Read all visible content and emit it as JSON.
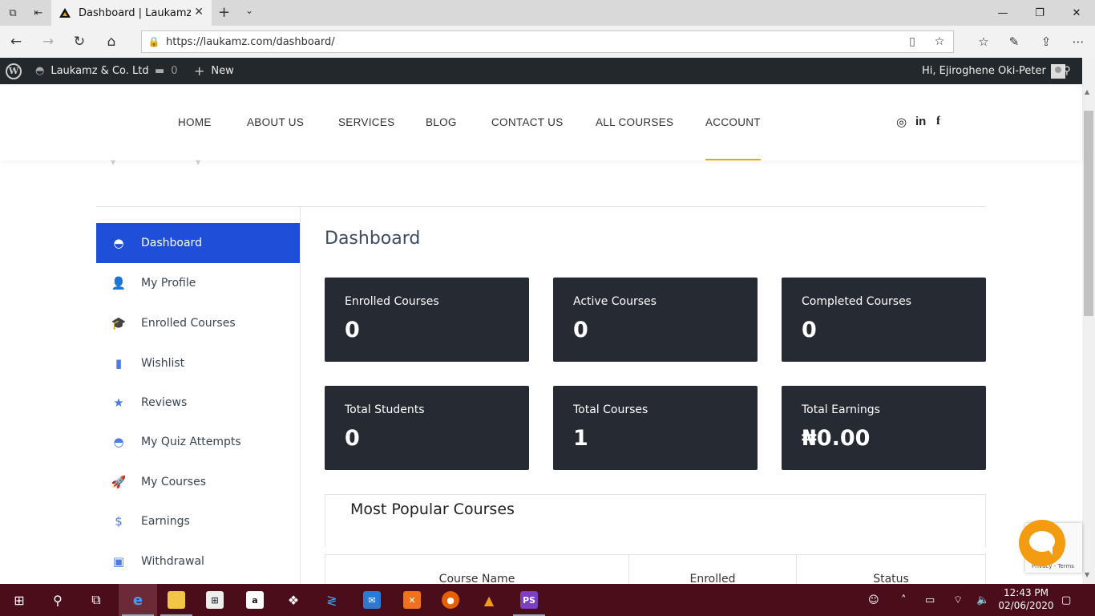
{
  "browser": {
    "tab_title": "Dashboard | Laukamz &",
    "url": "https://laukamz.com/dashboard/"
  },
  "wp_admin_bar": {
    "site_name": "Laukamz & Co. Ltd",
    "comments_count": "0",
    "new_label": "New",
    "greeting": "Hi, Ejiroghene Oki-Peter"
  },
  "nav": {
    "items": [
      "HOME",
      "ABOUT US",
      "SERVICES",
      "BLOG",
      "CONTACT US",
      "ALL COURSES",
      "ACCOUNT"
    ],
    "active": "ACCOUNT",
    "accent_color": "#f0a500"
  },
  "sidebar": {
    "items": [
      {
        "label": "Dashboard",
        "icon": "gauge-icon"
      },
      {
        "label": "My Profile",
        "icon": "user-icon"
      },
      {
        "label": "Enrolled Courses",
        "icon": "graduation-cap-icon"
      },
      {
        "label": "Wishlist",
        "icon": "bookmark-icon"
      },
      {
        "label": "Reviews",
        "icon": "star-icon"
      },
      {
        "label": "My Quiz Attempts",
        "icon": "gauge-icon"
      },
      {
        "label": "My Courses",
        "icon": "rocket-icon"
      },
      {
        "label": "Earnings",
        "icon": "dollar-icon"
      },
      {
        "label": "Withdrawal",
        "icon": "wallet-icon"
      }
    ],
    "active_color": "#1f4fd9"
  },
  "main": {
    "title": "Dashboard",
    "cards": [
      {
        "label": "Enrolled Courses",
        "value": "0"
      },
      {
        "label": "Active Courses",
        "value": "0"
      },
      {
        "label": "Completed Courses",
        "value": "0"
      },
      {
        "label": "Total Students",
        "value": "0"
      },
      {
        "label": "Total Courses",
        "value": "1"
      },
      {
        "label": "Total Earnings",
        "value": "₦0.00"
      }
    ],
    "popular": {
      "title": "Most Popular Courses",
      "columns": [
        "Course Name",
        "Enrolled",
        "Status"
      ]
    }
  },
  "recaptcha": {
    "text": "Privacy - Terms"
  },
  "taskbar": {
    "time": "12:43 PM",
    "date": "02/06/2020"
  }
}
